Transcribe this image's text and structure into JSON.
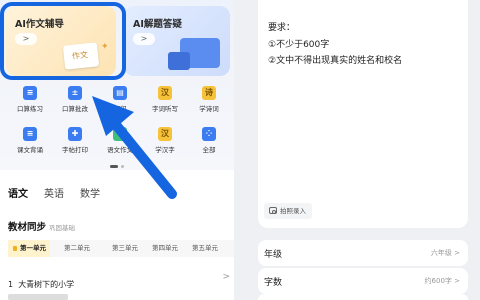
{
  "feature_cards": {
    "writing": {
      "title": "AI作文辅导",
      "go": ">",
      "paper_text": "作文",
      "sparkle": "✦"
    },
    "qa": {
      "title": "AI解题答疑",
      "go": ">"
    }
  },
  "tools": [
    {
      "label": "口算练习",
      "glyph": "≡",
      "icon": "calc-practice-icon"
    },
    {
      "label": "口算批改",
      "glyph": "±",
      "icon": "calc-check-icon"
    },
    {
      "label": "打印",
      "glyph": "▤",
      "icon": "print-icon"
    },
    {
      "label": "字词听写",
      "glyph": "汉",
      "icon": "dictation-icon"
    },
    {
      "label": "学诗词",
      "glyph": "诗",
      "icon": "poetry-icon"
    },
    {
      "label": "课文背诵",
      "glyph": "≡",
      "icon": "recite-icon"
    },
    {
      "label": "字帖打印",
      "glyph": "✚",
      "icon": "copybook-icon"
    },
    {
      "label": "语文作文",
      "glyph": "✎",
      "icon": "composition-icon"
    },
    {
      "label": "学汉字",
      "glyph": "汉",
      "icon": "hanzi-icon"
    },
    {
      "label": "全部",
      "glyph": "⁘",
      "icon": "all-apps-icon"
    }
  ],
  "subjects": [
    "语文",
    "英语",
    "数学"
  ],
  "textbook": {
    "title": "教材同步",
    "subtitle": "巩固基础"
  },
  "units": [
    "第一单元",
    "第二单元",
    "第三单元",
    "第四单元",
    "第五单元"
  ],
  "lesson": {
    "number": "1",
    "name": "大青树下的小学",
    "chevron": ">"
  },
  "requirements": {
    "title": "要求：",
    "items": [
      "①不少于600字",
      "②文中不得出现真实的姓名和校名"
    ]
  },
  "photo_button": "拍照录入",
  "rows": [
    {
      "label": "年级",
      "value": "六年级 >"
    },
    {
      "label": "字数",
      "value": "约600字 >"
    }
  ],
  "colors": {
    "highlight": "#1565e0",
    "accent_yellow": "#f2b01e"
  }
}
